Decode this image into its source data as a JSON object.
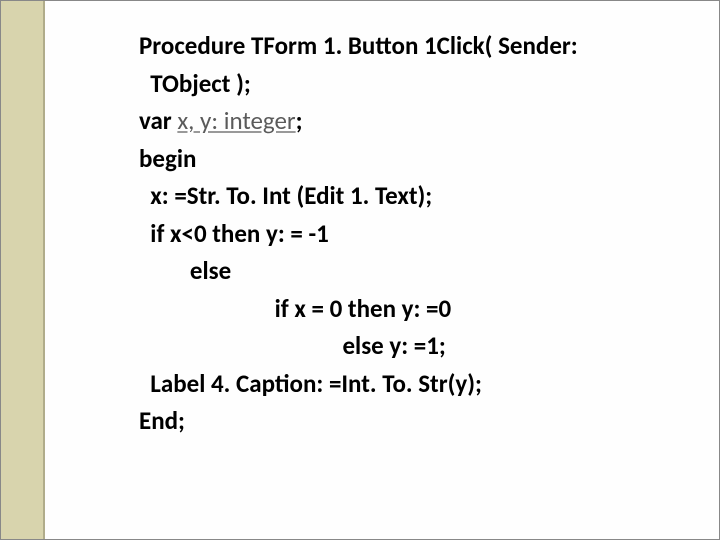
{
  "code": {
    "l1a": "Procedure TForm 1. Button 1Click( Sender:",
    "l1b": "  TObject );",
    "l2a": "var ",
    "l2b": "x, y: integer",
    "l2c": ";",
    "l3": "begin",
    "l4": "  x: =Str. To. Int (Edit 1. Text);",
    "l5": "  if x<0 then y: = -1",
    "l6": "         else",
    "l7": "                        if x = 0 then y: =0",
    "l8": "                                    else y: =1;",
    "l9": "  Label 4. Caption: =Int. To. Str(y);",
    "l10": "End;"
  }
}
